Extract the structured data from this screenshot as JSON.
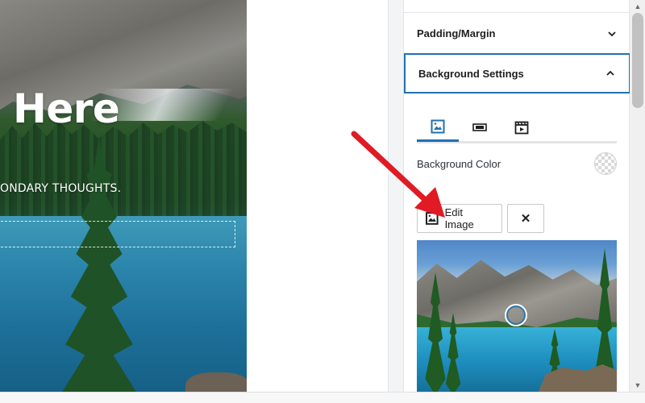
{
  "preview": {
    "heading": "Here",
    "subheading": "ONDARY THOUGHTS."
  },
  "sidebar": {
    "panels": [
      {
        "label": "Padding/Margin",
        "state": "collapsed",
        "icon": "chevron-down-icon"
      },
      {
        "label": "Background Settings",
        "state": "expanded",
        "icon": "chevron-up-icon"
      }
    ],
    "background_tabs": [
      {
        "name": "image-tab",
        "icon": "image-icon",
        "active": true
      },
      {
        "name": "gradient-tab",
        "icon": "slider-icon",
        "active": false
      },
      {
        "name": "video-tab",
        "icon": "video-icon",
        "active": false
      }
    ],
    "background_color_label": "Background Color",
    "edit_image_label": "Edit Image",
    "remove_image_label": "✕"
  },
  "colors": {
    "accent": "#2271b1",
    "annotation_arrow": "#e01b24"
  }
}
